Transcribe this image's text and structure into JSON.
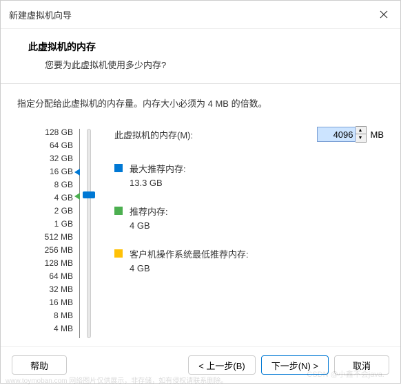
{
  "titlebar": {
    "title": "新建虚拟机向导"
  },
  "header": {
    "title": "此虚拟机的内存",
    "subtitle": "您要为此虚拟机使用多少内存?"
  },
  "instruction": "指定分配给此虚拟机的内存量。内存大小必须为 4 MB 的倍数。",
  "memory": {
    "label": "此虚拟机的内存(M):",
    "value": "4096",
    "unit": "MB"
  },
  "scale": {
    "labels": [
      "128 GB",
      "64 GB",
      "32 GB",
      "16 GB",
      "8 GB",
      "4 GB",
      "2 GB",
      "1 GB",
      "512 MB",
      "256 MB",
      "128 MB",
      "64 MB",
      "32 MB",
      "16 MB",
      "8 MB",
      "4 MB"
    ]
  },
  "recommendations": {
    "max": {
      "label": "最大推荐内存:",
      "value": "13.3 GB"
    },
    "rec": {
      "label": "推荐内存:",
      "value": "4 GB"
    },
    "min": {
      "label": "客户机操作系统最低推荐内存:",
      "value": "4 GB"
    }
  },
  "footer": {
    "help": "帮助",
    "back": "< 上一步(B)",
    "next": "下一步(N) >",
    "cancel": "取消"
  },
  "watermark": "CSDN @小鑫不会java.",
  "note": "www.toymoban.com 网络图片仅供展示，非存储，如有侵权请联系删除。"
}
